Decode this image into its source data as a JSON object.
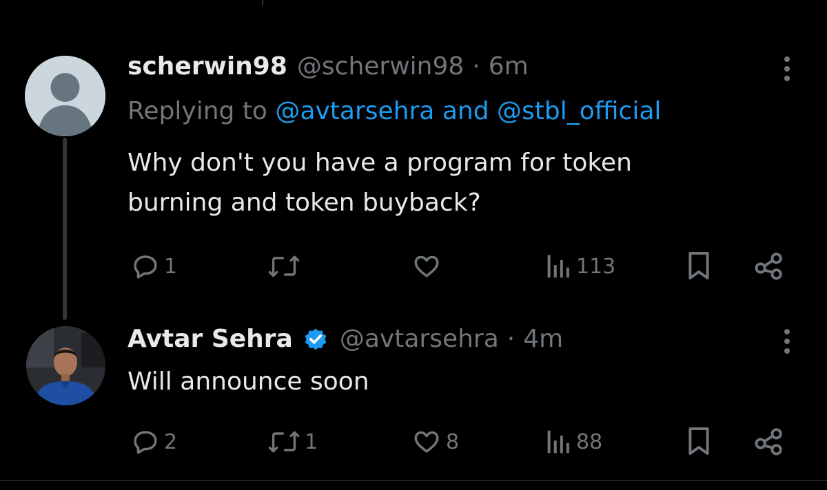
{
  "tweets": [
    {
      "name": "scherwin98",
      "handle": "@scherwin98",
      "separator": "·",
      "time": "6m",
      "replying_prefix": "Replying to",
      "mention_1": "@avtarsehra",
      "conjunction": "and",
      "mention_2": "@stbl_official",
      "text_line_1": "Why don't you have a program for token",
      "text_line_2": "burning and token buyback?",
      "actions": {
        "replies": "1",
        "reposts": "",
        "likes": "",
        "views": "113"
      },
      "avatar_icon": "default-profile-icon"
    },
    {
      "name": "Avtar Sehra",
      "verified": true,
      "handle": "@avtarsehra",
      "separator": "·",
      "time": "4m",
      "text_line_1": "Will announce soon",
      "actions": {
        "replies": "2",
        "reposts": "1",
        "likes": "8",
        "views": "88"
      },
      "avatar_icon": "profile-photo"
    }
  ],
  "colors": {
    "background": "#000000",
    "text": "#e7e9ea",
    "secondary": "#71767b",
    "accent": "#1d9bf0",
    "divider": "#2f3336"
  },
  "icons": [
    "reply-icon",
    "repost-icon",
    "like-icon",
    "views-icon",
    "bookmark-icon",
    "share-icon",
    "more-icon",
    "verified-badge-icon"
  ]
}
